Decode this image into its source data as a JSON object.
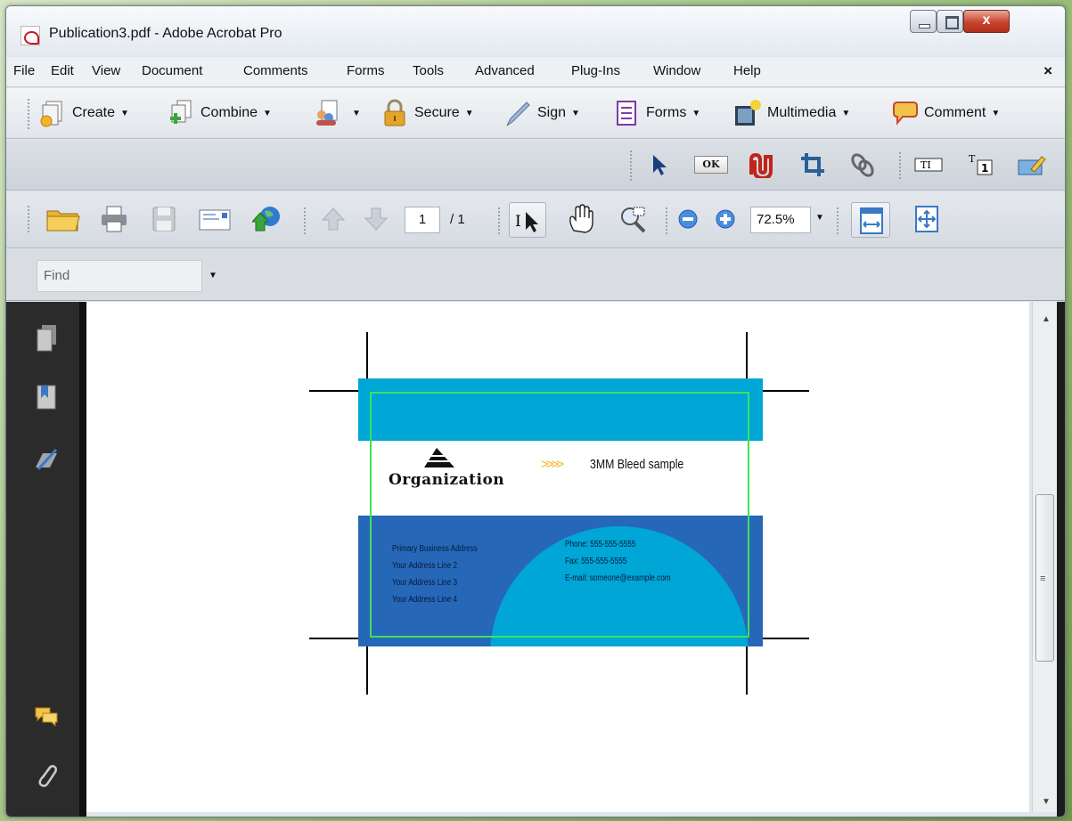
{
  "window": {
    "title": "Publication3.pdf - Adobe Acrobat Pro",
    "close_glyph": "x"
  },
  "menu": {
    "items": [
      "File",
      "Edit",
      "View",
      "Document",
      "Comments",
      "Forms",
      "Tools",
      "Advanced",
      "Plug-Ins",
      "Window",
      "Help"
    ],
    "close_glyph": "×"
  },
  "tasks": {
    "create": "Create",
    "combine": "Combine",
    "secure": "Secure",
    "sign": "Sign",
    "forms": "Forms",
    "multimedia": "Multimedia",
    "comment": "Comment",
    "caret": "▼"
  },
  "advanced_tools": {
    "ok_label": "OK"
  },
  "file_toolbar": {
    "page_current": "1",
    "page_total": "/ 1",
    "zoom": "72.5%",
    "caret": "▼"
  },
  "find": {
    "placeholder": "Find",
    "caret": "▼"
  },
  "scrollbar": {
    "up": "▲",
    "down": "▼",
    "grip": "≡"
  },
  "card": {
    "organization": "Organization",
    "bleed_arrows": ">>>>",
    "bleed_title": "3MM Bleed sample",
    "address_lines": [
      "Primary Business Address",
      "Your Address Line 2",
      "Your Address Line 3",
      "Your Address Line 4"
    ],
    "contact_lines": [
      "Phone: 555-555-5555",
      "Fax: 555-555-5555",
      "E-mail: someone@example.com"
    ],
    "colors": {
      "cyan": "#00a6d6",
      "blue": "#2767b8",
      "bleed_line": "#3ce35a",
      "arrows": "#f2b21a"
    }
  }
}
